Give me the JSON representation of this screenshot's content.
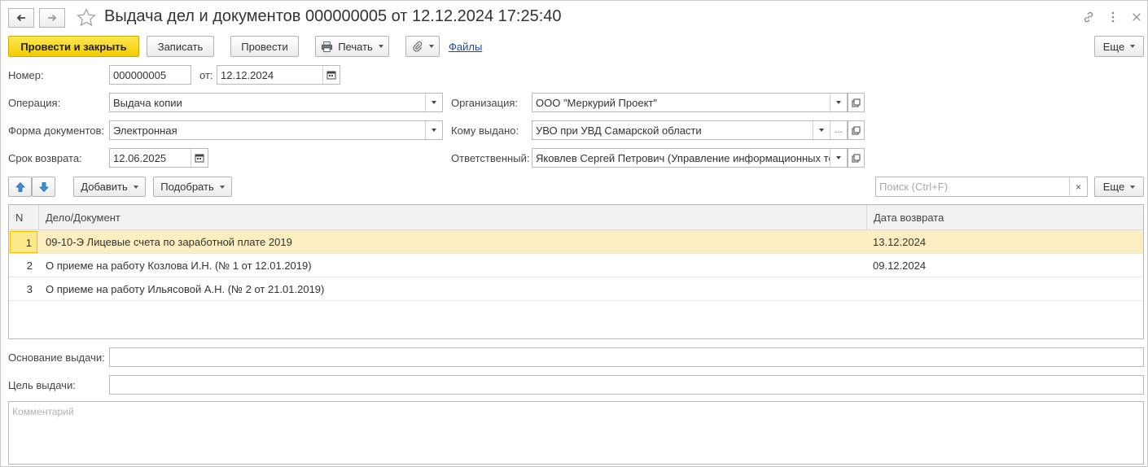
{
  "window": {
    "title": "Выдача дел и документов 000000005 от 12.12.2024 17:25:40"
  },
  "toolbar": {
    "post_and_close": "Провести и закрыть",
    "save": "Записать",
    "post": "Провести",
    "print": "Печать",
    "files": "Файлы",
    "more": "Еще"
  },
  "form": {
    "number_label": "Номер:",
    "number_value": "000000005",
    "date_label": "от:",
    "date_value": "12.12.2024",
    "operation_label": "Операция:",
    "operation_value": "Выдача копии",
    "organization_label": "Организация:",
    "organization_value": "ООО \"Меркурий Проект\"",
    "doc_form_label": "Форма документов:",
    "doc_form_value": "Электронная",
    "issued_to_label": "Кому выдано:",
    "issued_to_value": "УВО при УВД Самарской области",
    "return_label": "Срок возврата:",
    "return_value": "12.06.2025",
    "responsible_label": "Ответственный:",
    "responsible_value": "Яковлев Сергей Петрович (Управление информационных те:"
  },
  "table_toolbar": {
    "add": "Добавить",
    "pick": "Подобрать",
    "search_placeholder": "Поиск (Ctrl+F)",
    "clear": "×",
    "more": "Еще"
  },
  "table": {
    "columns": [
      "N",
      "Дело/Документ",
      "Дата возврата"
    ],
    "rows": [
      {
        "n": "1",
        "doc": "09-10-Э Лицевые счета по заработной плате 2019",
        "date": "13.12.2024"
      },
      {
        "n": "2",
        "doc": "О приеме на работу Козлова И.Н. (№ 1 от 12.01.2019)",
        "date": "09.12.2024"
      },
      {
        "n": "3",
        "doc": "О приеме на работу Ильясовой А.Н. (№ 2 от 21.01.2019)",
        "date": ""
      }
    ]
  },
  "bottom": {
    "basis_label": "Основание выдачи:",
    "basis_value": "",
    "purpose_label": "Цель выдачи:",
    "purpose_value": "",
    "comment_placeholder": "Комментарий"
  },
  "icons": {
    "back": "arrow-left-icon",
    "forward": "arrow-right-icon",
    "favorite": "star-icon",
    "link": "link-icon",
    "menu": "more-vertical-icon",
    "close": "close-icon"
  }
}
